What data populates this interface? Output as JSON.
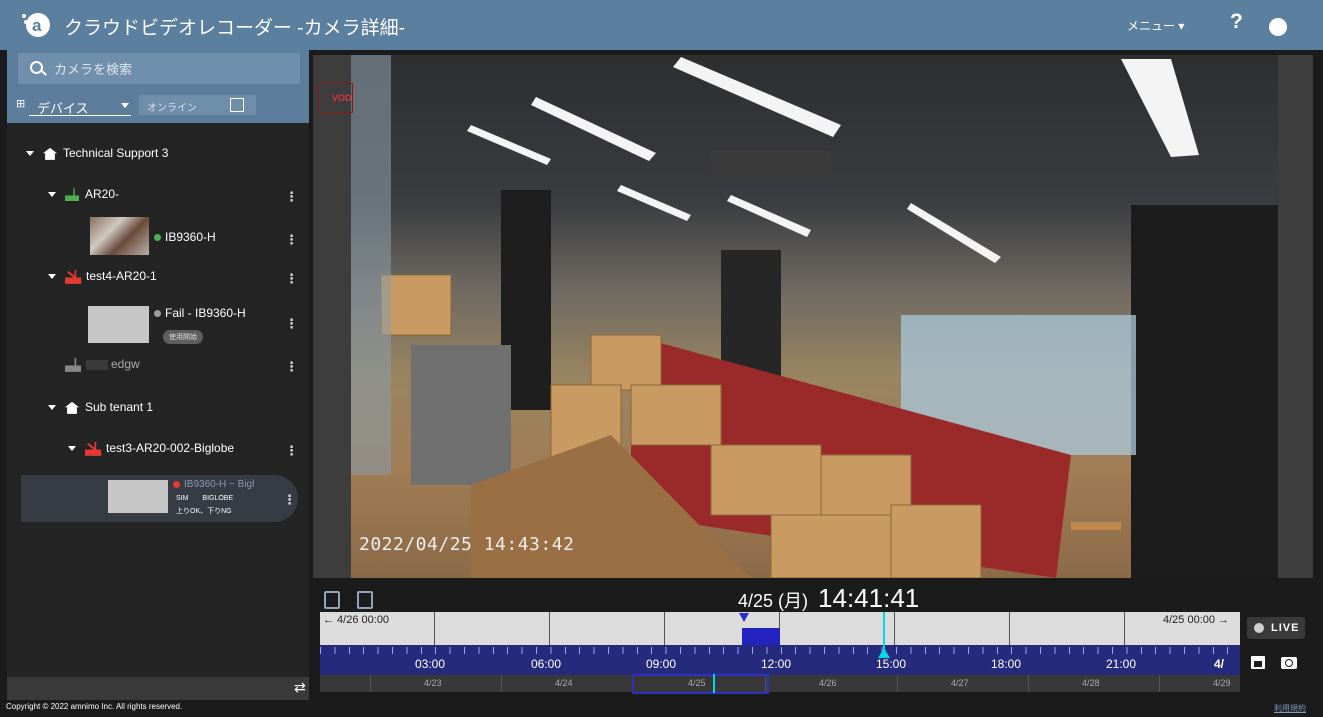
{
  "header": {
    "title": "クラウドビデオレコーダー",
    "subtitle": " -カメラ詳細-",
    "menu_label": "メニュー ▾",
    "help_label": "?"
  },
  "sidebar": {
    "search_placeholder": "カメラを検索",
    "device_select": "デバイス",
    "online_filter": "オンライン",
    "tree": {
      "root": "Technical Support 3",
      "ar20": "AR20-",
      "cam1": "IB9360-H",
      "test4": "test4-AR20-1",
      "cam2": "Fail - IB9360-H",
      "cam2_badge": "使用開始",
      "edgw": "edgw",
      "sub_tenant": "Sub tenant 1",
      "test3": "test3-AR20-002-Biglobe",
      "cam3": "IB9360-H ~ Bigl",
      "cam3_sim": "SIM",
      "cam3_carrier": "BIGLOBE",
      "cam3_status": "上りOK、下りNG"
    }
  },
  "video": {
    "vod_label": "VOD",
    "timestamp": "2022/04/25 14:43:42"
  },
  "playback": {
    "date": "4/25 (月)",
    "time": "14:41:41"
  },
  "timeline": {
    "left_label": "← 4/26 00:00",
    "right_label": "4/25 00:00 →",
    "hours": [
      "03:00",
      "06:00",
      "09:00",
      "12:00",
      "15:00",
      "18:00",
      "21:00",
      "4/"
    ],
    "days": [
      "4/23",
      "4/24",
      "4/25",
      "4/26",
      "4/27",
      "4/28",
      "4/29"
    ]
  },
  "controls": {
    "live_label": "LIVE"
  },
  "footer": {
    "copyright": "Copyright © 2022 amnimo Inc. All rights reserved.",
    "terms": "利用規約"
  },
  "colors": {
    "header": "#5b7f9f",
    "sidebar": "#242424",
    "timeline_hours": "#262a7c",
    "cursor": "#00d8e8",
    "status_online": "#4caf50",
    "status_error": "#e53935"
  },
  "icons": [
    "logo-icon",
    "search-icon",
    "device-tree-icon",
    "home-icon",
    "router-icon",
    "router-offline-icon",
    "help-icon",
    "user-icon",
    "copy-icon",
    "calendar-icon",
    "camera-snapshot-icon",
    "swap-icon"
  ]
}
